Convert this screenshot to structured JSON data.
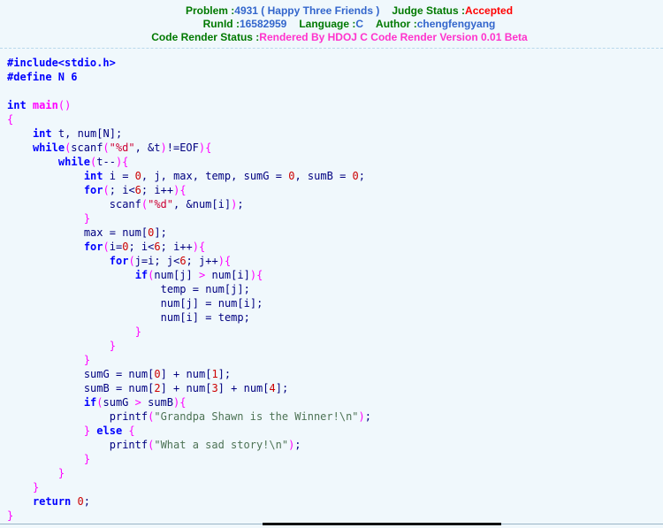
{
  "header": {
    "line1": {
      "problem_label": "Problem :",
      "problem_value": "4931 ( Happy Three Friends )",
      "judge_label": "Judge Status :",
      "judge_value": "Accepted"
    },
    "line2": {
      "runid_label": "RunId :",
      "runid_value": "16582959",
      "language_label": "Language :",
      "language_value": "C",
      "author_label": "Author :",
      "author_value": "chengfengyang"
    },
    "line3": {
      "render_label": "Code Render Status :",
      "render_value": "Rendered By HDOJ C Code Render Version 0.01 Beta"
    }
  },
  "colors": {
    "label_green": "#007900",
    "value_blue": "#3366cc",
    "accepted_red": "#ff0000",
    "render_magenta": "#ff33cc",
    "background": "#f0f8fc",
    "keyword_blue": "#0000ff",
    "function_magenta": "#ff00ff",
    "identifier_navy": "#000080",
    "number_red": "#cc0000",
    "string_red": "#cc0033",
    "string_green": "#4d7355"
  },
  "code": {
    "language": "C",
    "lines": [
      "#include<stdio.h>",
      "#define N 6",
      "",
      "int main()",
      "{",
      "    int t, num[N];",
      "    while(scanf(\"%d\", &t)!=EOF){",
      "        while(t--){",
      "            int i = 0, j, max, temp, sumG = 0, sumB = 0;",
      "            for(; i<6; i++){",
      "                scanf(\"%d\", &num[i]);",
      "            }",
      "            max = num[0];",
      "            for(i=0; i<6; i++){",
      "                for(j=i; j<6; j++){",
      "                    if(num[j] > num[i]){",
      "                        temp = num[j];",
      "                        num[j] = num[i];",
      "                        num[i] = temp;",
      "                    }",
      "                }",
      "            }",
      "            sumG = num[0] + num[1];",
      "            sumB = num[2] + num[3] + num[4];",
      "            if(sumG > sumB){",
      "                printf(\"Grandpa Shawn is the Winner!\\n\");",
      "            } else {",
      "                printf(\"What a sad story!\\n\");",
      "            }",
      "        }",
      "    }",
      "    return 0;",
      "}"
    ]
  }
}
